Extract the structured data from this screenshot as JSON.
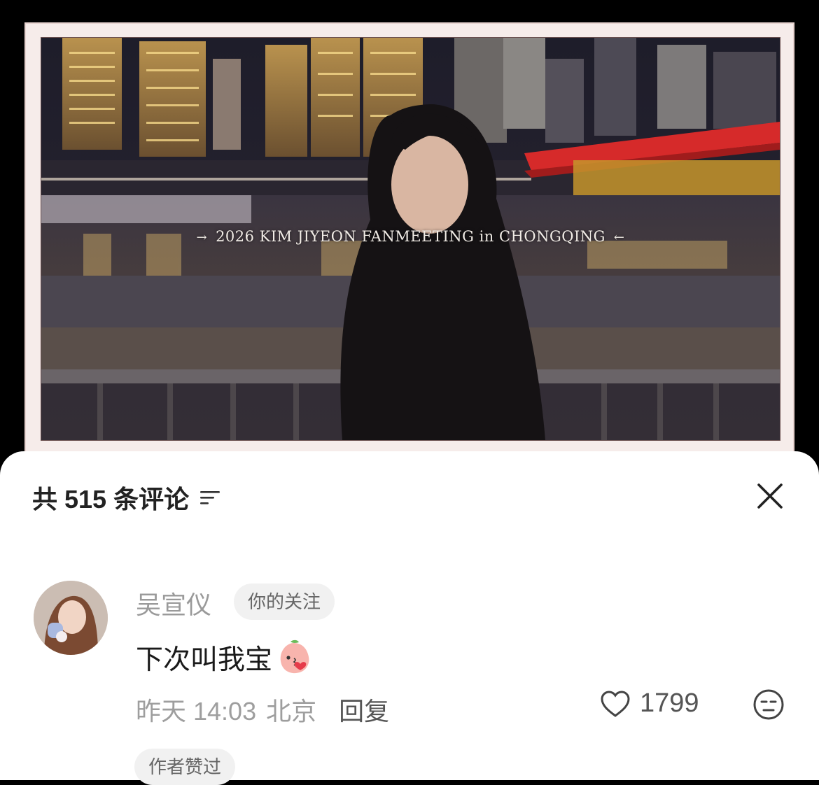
{
  "video": {
    "caption": "2026 KIM JIYEON FANMEETING in CHONGQING",
    "caption_arrow_left": "→",
    "caption_arrow_right": "←"
  },
  "comments_panel": {
    "count_label": "共 515 条评论",
    "sort_icon": "filter-lines-icon",
    "close_icon": "close-icon"
  },
  "comment": {
    "author": "吴宣仪",
    "follow_badge": "你的关注",
    "text": "下次叫我宝",
    "emoji": "peach-kiss-emoji",
    "timestamp": "昨天 14:03",
    "location": "北京",
    "reply_label": "回复",
    "like_count": "1799",
    "author_liked_badge": "作者赞过"
  },
  "colors": {
    "sheet_bg": "#ffffff",
    "frame_bg": "#f6ecea",
    "muted_text": "#9a9a9a",
    "badge_bg": "#f1f1f1"
  }
}
